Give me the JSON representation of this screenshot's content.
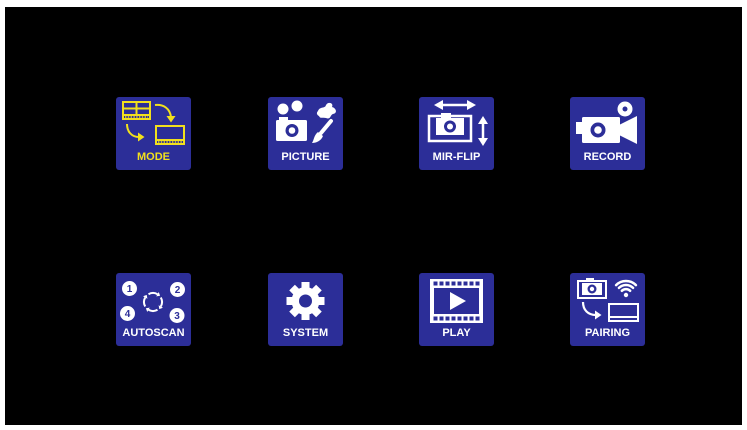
{
  "colors": {
    "frame": "#ffffff",
    "screen": "#000000",
    "tile": "#2c2e98",
    "highlight": "#f2e01d",
    "text": "#ffffff"
  },
  "menu": {
    "items": [
      {
        "label": "MODE",
        "icon": "mode-icon",
        "selected": true
      },
      {
        "label": "PICTURE",
        "icon": "picture-icon",
        "selected": false
      },
      {
        "label": "MIR-FLIP",
        "icon": "mirror-flip-icon",
        "selected": false
      },
      {
        "label": "RECORD",
        "icon": "video-camera-icon",
        "selected": false
      },
      {
        "label": "AUTOSCAN",
        "icon": "autoscan-cycle-icon",
        "selected": false,
        "steps": [
          "1",
          "2",
          "3",
          "4"
        ]
      },
      {
        "label": "SYSTEM",
        "icon": "gear-icon",
        "selected": false
      },
      {
        "label": "PLAY",
        "icon": "film-play-icon",
        "selected": false
      },
      {
        "label": "PAIRING",
        "icon": "wifi-pairing-icon",
        "selected": false
      }
    ]
  }
}
